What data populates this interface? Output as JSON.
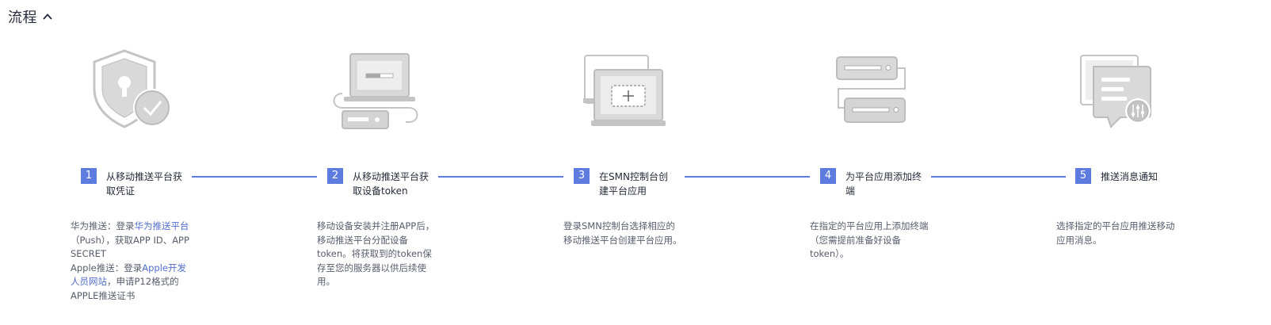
{
  "header": {
    "title": "流程",
    "toggle_icon": "chevron-up-icon"
  },
  "colors": {
    "accent": "#5e7ce0",
    "link": "#526ecc",
    "text": "#252b3a",
    "desc": "#575d6c",
    "icon_gray": "#c4c4c4"
  },
  "steps": [
    {
      "number": "1",
      "title_lines": [
        "从移动推送平台获",
        "取凭证"
      ],
      "icon": "shield-check-icon",
      "desc": {
        "l1_text": "华为推送：登录",
        "l1_link": "华为推送平台",
        "l2": "（Push），获取APP ID、APP",
        "l3": "SECRET",
        "l4_text": "Apple推送：登录",
        "l4_link": "Apple开发",
        "l5_link": "人员网站",
        "l5_text": "，申请P12格式的",
        "l6": "APPLE推送证书"
      }
    },
    {
      "number": "2",
      "title_lines": [
        "从移动推送平台获",
        "取设备token"
      ],
      "icon": "laptop-device-icon",
      "desc_lines": [
        "移动设备安装并注册APP后，",
        "移动推送平台分配设备",
        "token。将获取到的token保",
        "存至您的服务器以供后续使",
        "用。"
      ]
    },
    {
      "number": "3",
      "title_lines": [
        "在SMN控制台创",
        "建平台应用"
      ],
      "icon": "create-app-icon",
      "desc_lines": [
        "登录SMN控制台选择相应的",
        "移动推送平台创建平台应用。"
      ]
    },
    {
      "number": "4",
      "title_lines": [
        "为平台应用添加终",
        "端"
      ],
      "icon": "endpoint-servers-icon",
      "desc_lines": [
        "在指定的平台应用上添加终端",
        "（您需提前准备好设备",
        "token）。"
      ]
    },
    {
      "number": "5",
      "title_lines": [
        "推送消息通知"
      ],
      "icon": "message-settings-icon",
      "desc_lines": [
        "选择指定的平台应用推送移动",
        "应用消息。"
      ]
    }
  ]
}
